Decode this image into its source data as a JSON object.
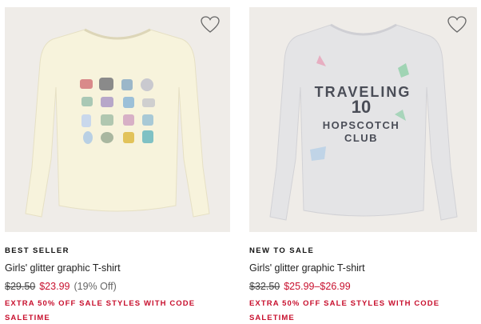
{
  "products": [
    {
      "badge": "BEST SELLER",
      "name": "Girls' glitter graphic T-shirt",
      "price_original": "$29.50",
      "price_sale": "$23.99",
      "discount": "(19% Off)",
      "promo_line1": "EXTRA 50% OFF SALE STYLES WITH CODE",
      "promo_line2": "SALETIME",
      "shirt_color": "#f7f3dc",
      "wishlist_icon": "heart-outline-icon"
    },
    {
      "badge": "NEW TO SALE",
      "name": "Girls' glitter graphic T-shirt",
      "price_original": "$32.50",
      "price_sale": "$25.99–$26.99",
      "discount": "",
      "promo_line1": "EXTRA 50% OFF SALE STYLES WITH CODE",
      "promo_line2": "SALETIME",
      "shirt_color": "#e4e4e6",
      "graphic_text_top": "TRAVELING",
      "graphic_text_number": "10",
      "graphic_text_mid": "HOPSCOTCH",
      "graphic_text_bottom": "CLUB",
      "wishlist_icon": "heart-outline-icon"
    }
  ],
  "colors": {
    "sale_red": "#c8102e",
    "tile_bg": "#efece8"
  }
}
